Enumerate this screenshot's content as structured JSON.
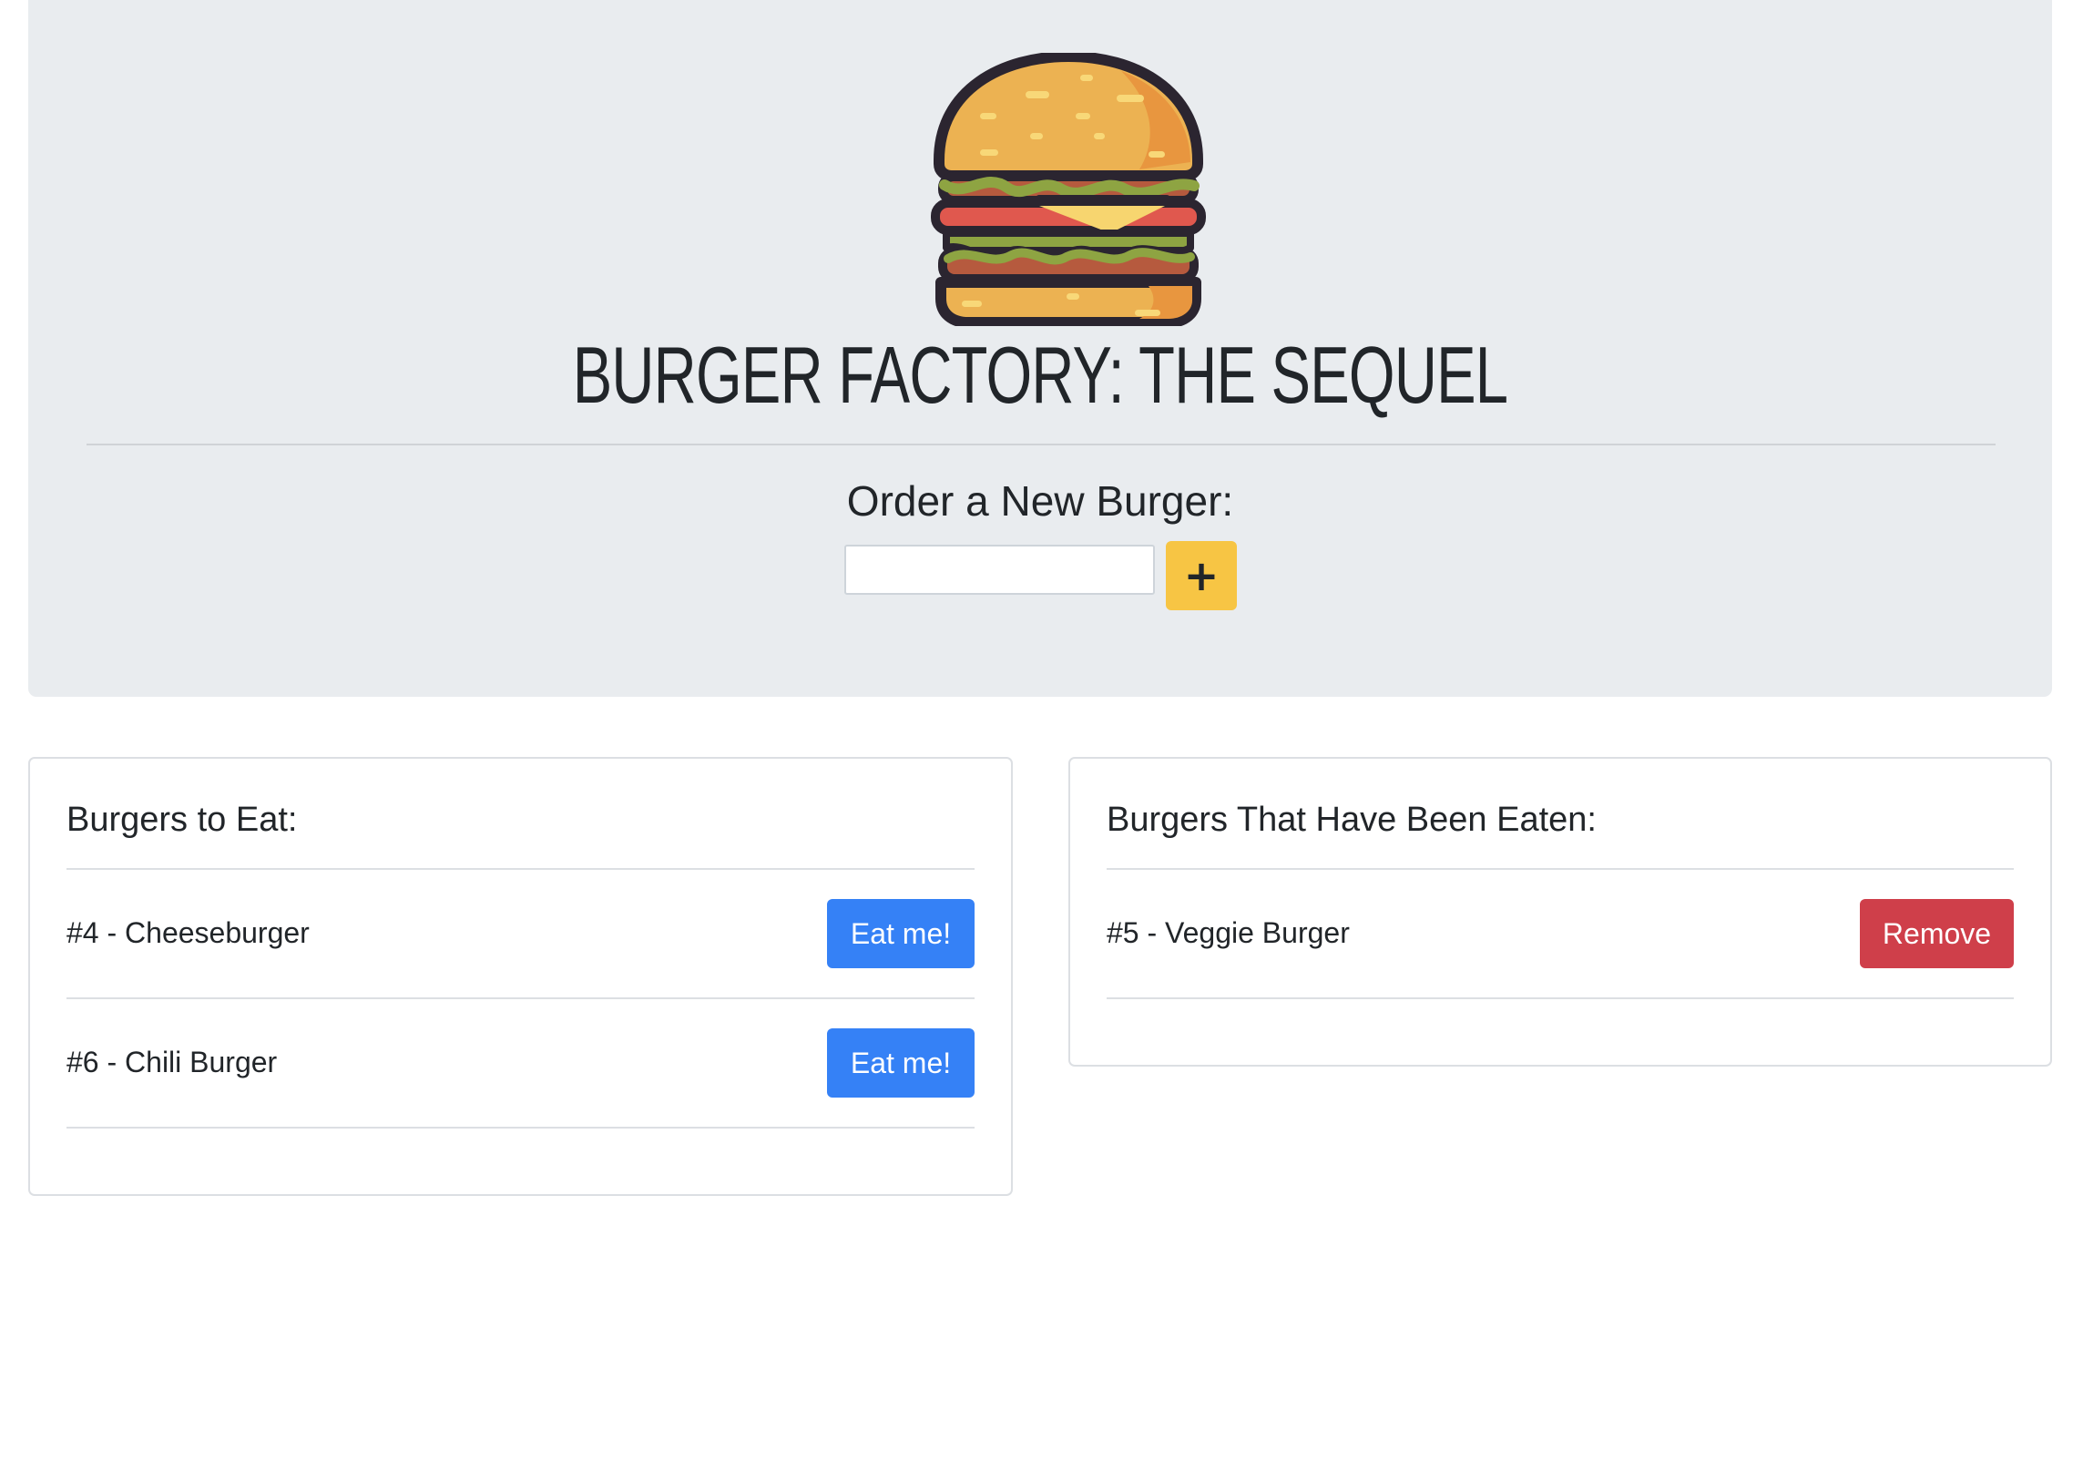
{
  "header": {
    "logo_icon": "burger-icon",
    "title": "BURGER FACTORY: THE SEQUEL",
    "order_label": "Order a New Burger:",
    "order_input_value": "",
    "add_button_label": "+"
  },
  "to_eat": {
    "title": "Burgers to Eat:",
    "button_label": "Eat me!",
    "items": [
      {
        "label": "#4 - Cheeseburger"
      },
      {
        "label": "#6 - Chili Burger"
      }
    ]
  },
  "eaten": {
    "title": "Burgers That Have Been Eaten:",
    "button_label": "Remove",
    "items": [
      {
        "label": "#5 - Veggie Burger"
      }
    ]
  },
  "colors": {
    "jumbotron_bg": "#e9ecef",
    "add_button": "#f7c544",
    "eat_button": "#3581f6",
    "remove_button": "#cf3f4a"
  }
}
